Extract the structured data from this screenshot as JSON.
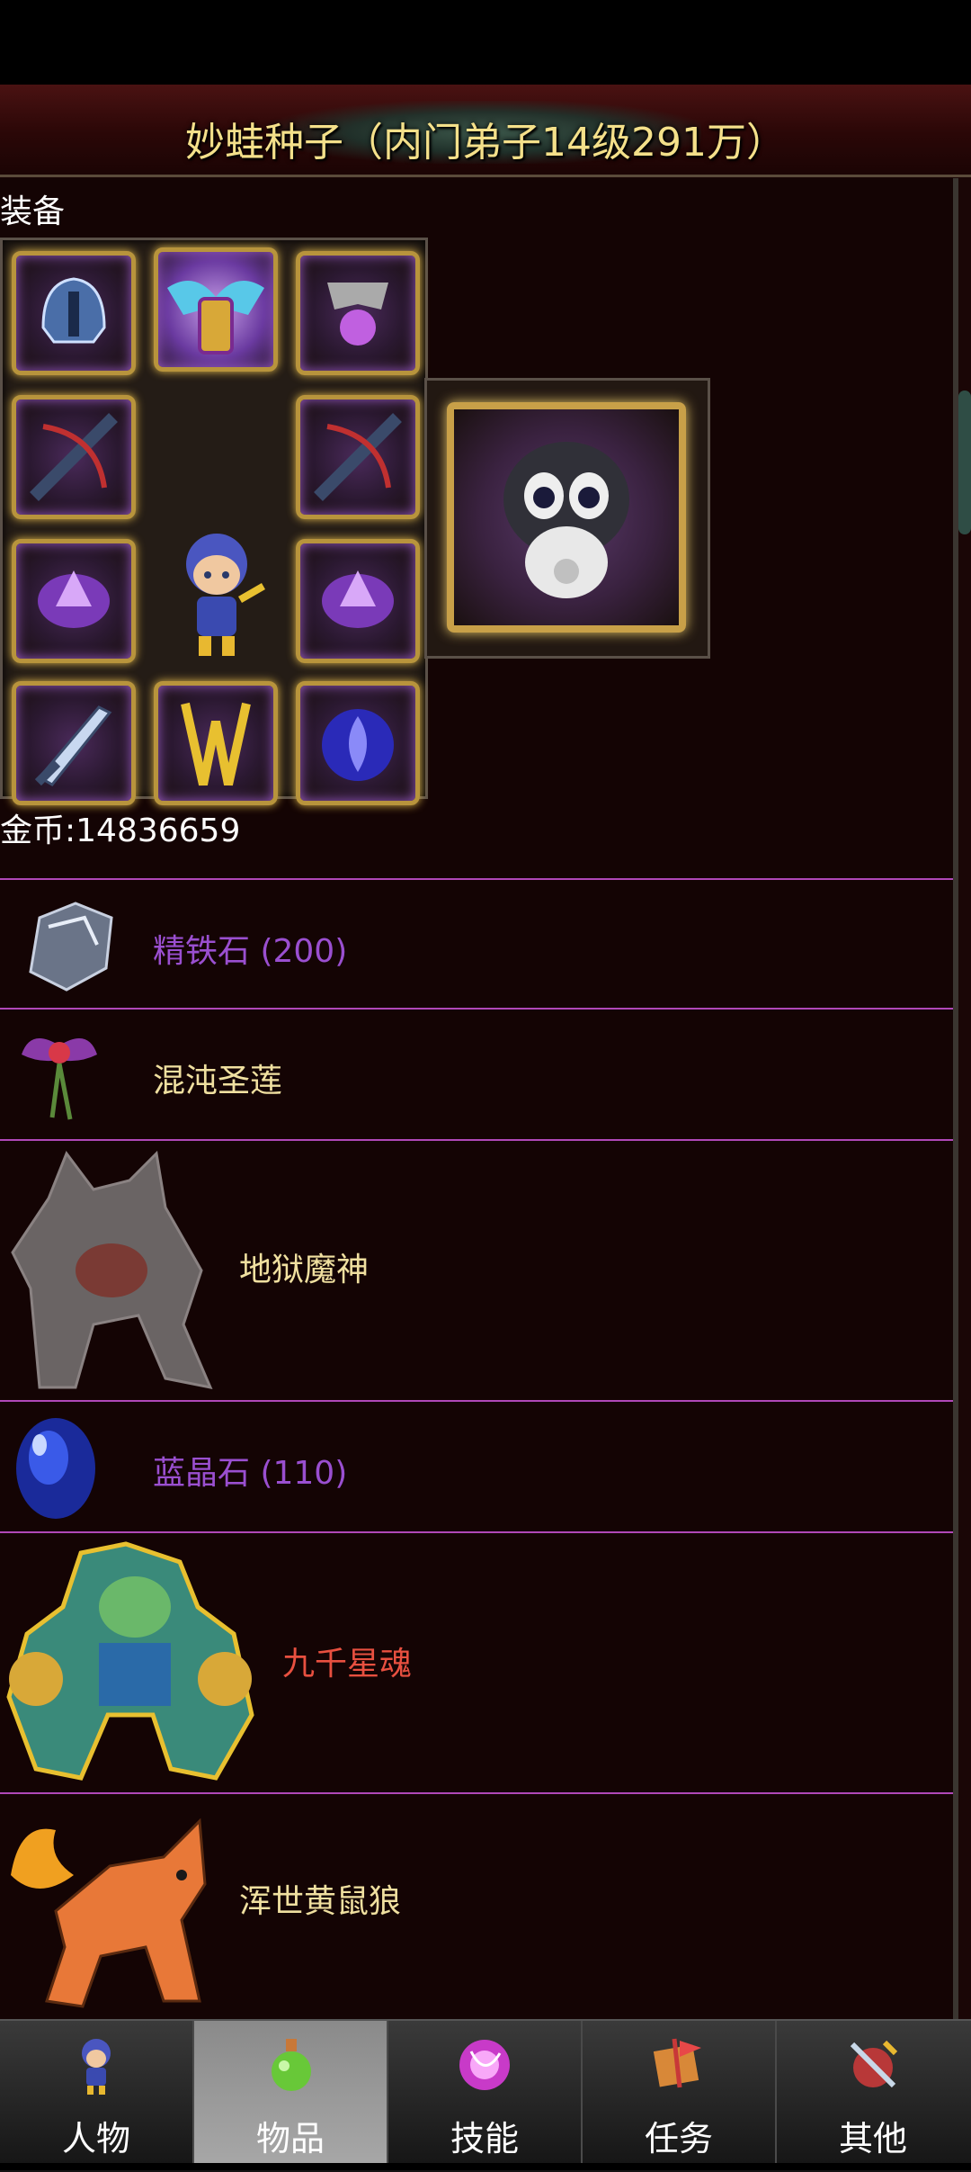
{
  "window": {
    "title": "妙蛙种子（内门弟子14级291万）"
  },
  "equipment": {
    "section_label": "装备",
    "slots": [
      {
        "name": "helmet-icon"
      },
      {
        "name": "necklace-icon"
      },
      {
        "name": "ornament-icon"
      },
      {
        "name": "bow-icon"
      },
      {
        "name": "bow-icon"
      },
      {
        "name": "purple-bracer-icon"
      },
      {
        "name": "purple-bracer-icon"
      },
      {
        "name": "sword-icon"
      },
      {
        "name": "golden-armor-icon"
      },
      {
        "name": "flame-orb-icon"
      }
    ],
    "pet_icon": "panda-pet-icon"
  },
  "gold": {
    "text": "金币:14836659"
  },
  "items": [
    {
      "name": "精铁石 (200)",
      "color": "#9a4fd0",
      "icon": "ore-icon"
    },
    {
      "name": "混沌圣莲",
      "color": "#f0e0a0",
      "icon": "lotus-icon"
    },
    {
      "name": "地狱魔神",
      "color": "#f0e0a0",
      "icon": "demon-icon"
    },
    {
      "name": "蓝晶石 (110)",
      "color": "#9a4fd0",
      "icon": "blue-crystal-icon"
    },
    {
      "name": "九千星魂",
      "color": "#e85040",
      "icon": "beast-warrior-icon"
    },
    {
      "name": "浑世黄鼠狼",
      "color": "#f0e0a0",
      "icon": "fire-weasel-icon"
    }
  ],
  "tabs": [
    {
      "label": "人物",
      "icon": "character-icon",
      "active": false
    },
    {
      "label": "物品",
      "icon": "potion-icon",
      "active": true
    },
    {
      "label": "技能",
      "icon": "skill-orb-icon",
      "active": false
    },
    {
      "label": "任务",
      "icon": "quest-icon",
      "active": false
    },
    {
      "label": "其他",
      "icon": "other-icon",
      "active": false
    }
  ]
}
